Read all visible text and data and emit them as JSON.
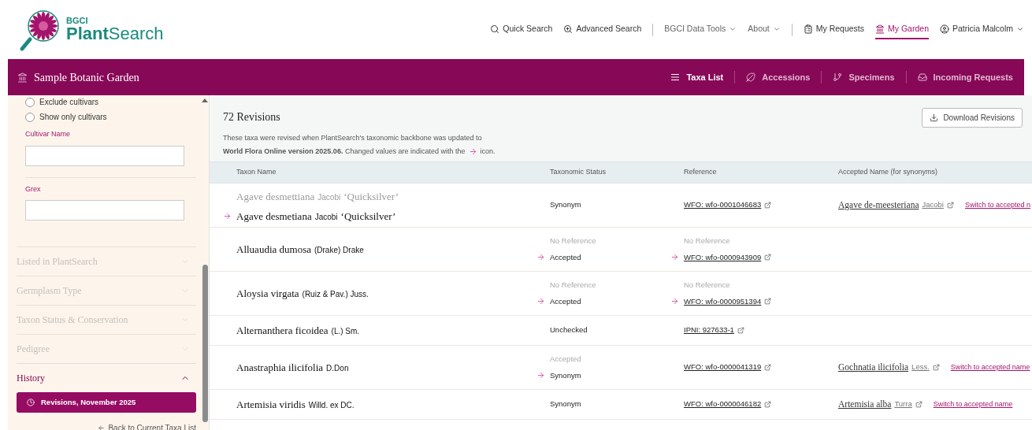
{
  "logo": {
    "org": "BGCI",
    "product": "**Plant**Search"
  },
  "nav": [
    {
      "kind": "search",
      "label": "Quick Search",
      "selected": false,
      "dropdown": false
    },
    {
      "kind": "advanced",
      "label": "Advanced Search",
      "selected": false,
      "dropdown": false
    },
    {
      "kind": "divider"
    },
    {
      "kind": "plain",
      "label": "BGCI Data Tools",
      "selected": false,
      "dropdown": true
    },
    {
      "kind": "plain",
      "label": "About",
      "selected": false,
      "dropdown": true
    },
    {
      "kind": "divider"
    },
    {
      "kind": "requests",
      "label": "My Requests",
      "selected": false,
      "dropdown": false
    },
    {
      "kind": "garden",
      "label": "My Garden",
      "selected": true,
      "dropdown": false
    },
    {
      "kind": "user",
      "label": "Patricia Malcolm",
      "selected": false,
      "dropdown": true
    }
  ],
  "garden_bar": {
    "title": "Sample Botanic Garden",
    "tabs": [
      {
        "kind": "list",
        "label": "Taxa List",
        "selected": true
      },
      {
        "kind": "leaf",
        "label": "Accessions",
        "selected": false
      },
      {
        "kind": "branch",
        "label": "Specimens",
        "selected": false
      },
      {
        "kind": "inbox",
        "label": "Incoming Requests",
        "selected": false
      }
    ]
  },
  "sidebar": {
    "radios": [
      {
        "label": "Exclude cultivars",
        "checked": false
      },
      {
        "label": "Show only cultivars",
        "checked": false
      }
    ],
    "fields": [
      {
        "label": "Cultivar Name"
      },
      {
        "label": "Grex"
      }
    ],
    "sections": [
      {
        "label": "Listed in PlantSearch",
        "expanded": false
      },
      {
        "label": "Germplasm Type",
        "expanded": false
      },
      {
        "label": "Taxon Status & Conservation",
        "expanded": false
      },
      {
        "label": "Pedigree",
        "expanded": false
      },
      {
        "label": "History",
        "expanded": true
      }
    ],
    "history_button": "Revisions, November 2025",
    "back_link": "Back to Current Taxa List"
  },
  "revisions": {
    "title": "72 Revisions",
    "description_line1": "These taxa were revised when PlantSearch's taxonomic backbone was updated to",
    "description_line2": "**World Flora Online version 2025.06.** Changed values are indicated with the",
    "description_end": "icon.",
    "download_button": "Download Revisions"
  },
  "table": {
    "columns": [
      "Taxon Name",
      "Taxonomic Status",
      "Reference",
      "Accepted Name (for synonyms)"
    ],
    "rows": [
      {
        "taxon_old": {
          "name": "Agave desmettiana",
          "author": "Jacobi",
          "cultivar": "‘Quicksilver’"
        },
        "taxon": {
          "name": "Agave desmetiana",
          "author": "Jacobi",
          "cultivar": "‘Quicksilver’"
        },
        "status": "Synonym",
        "reference": "WFO: wfo-0001046683",
        "accepted": {
          "name": "Agave de-meesteriana",
          "author": "Jacobi",
          "switch": "Switch to accepted n"
        }
      },
      {
        "taxon": {
          "name": "Alluaudia dumosa",
          "author": "(Drake) Drake"
        },
        "status_old": "No Reference",
        "status": "Accepted",
        "reference_old": "No Reference",
        "reference": "WFO: wfo-0000943909"
      },
      {
        "taxon": {
          "name": "Aloysia virgata",
          "author": "(Ruiz & Pav.) Juss."
        },
        "status_old": "No Reference",
        "status": "Accepted",
        "reference_old": "No Reference",
        "reference": "WFO: wfo-0000951394"
      },
      {
        "taxon": {
          "name": "Alternanthera ficoidea",
          "author": "(L.) Sm."
        },
        "status": "Unchecked",
        "reference": "IPNI: 927633-1"
      },
      {
        "taxon": {
          "name": "Anastraphia ilicifolia",
          "author": "D.Don"
        },
        "status_old": "Accepted",
        "status": "Synonym",
        "reference": "WFO: wfo-0000041319",
        "accepted": {
          "name": "Gochnatia ilicifolia",
          "author": "Less.",
          "switch": "Switch to accepted name"
        }
      },
      {
        "taxon": {
          "name": "Artemisia viridis",
          "author": "Willd. ex DC."
        },
        "status": "Synonym",
        "reference": "WFO: wfo-0000046182",
        "accepted": {
          "name": "Artemisia alba",
          "author": "Turra",
          "switch": "Switch to accepted name"
        }
      }
    ]
  }
}
